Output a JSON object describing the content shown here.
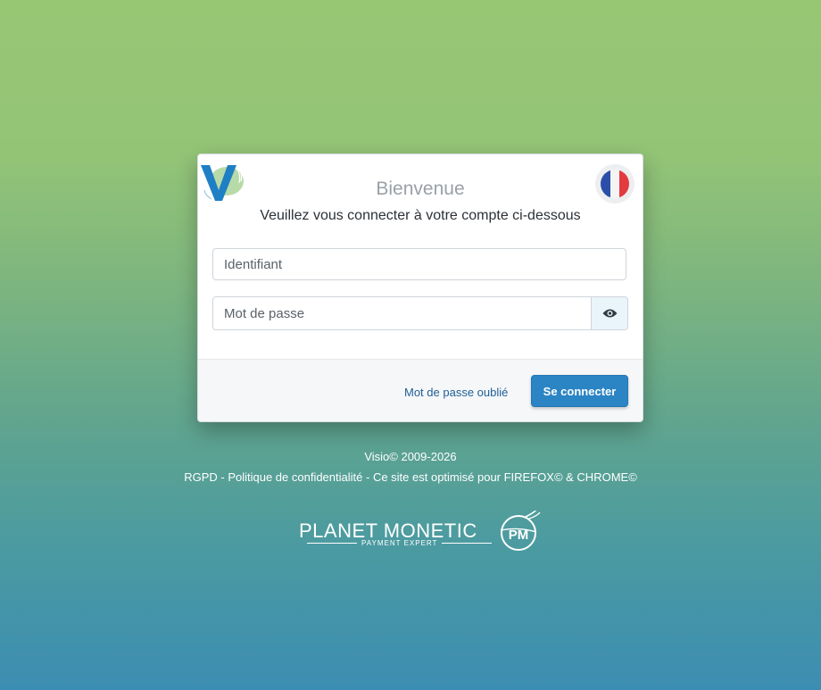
{
  "login": {
    "title": "Bienvenue",
    "subtitle": "Veuillez vous connecter à votre compte ci-dessous",
    "username_placeholder": "Identifiant",
    "password_placeholder": "Mot de passe",
    "forgot_label": "Mot de passe oublié",
    "submit_label": "Se connecter",
    "language_flag": "flag-france-icon"
  },
  "footer": {
    "copyright": "Visio© 2009-2026",
    "rgpd_link": "RGPD - Politique de confidentialité",
    "separator": " - ",
    "browser_note": "Ce site est optimisé pour FIREFOX© & CHROME©"
  },
  "partner": {
    "name": "PLANET MONETIC",
    "tagline": "PAYMENT EXPERT",
    "badge": "PM"
  },
  "colors": {
    "primary_button": "#2b84c4",
    "link": "#1f5f95",
    "logo_blue": "#1f7fc4",
    "logo_green": "#a8d39a",
    "background_top": "#98c774",
    "background_bottom": "#3c8db2"
  }
}
